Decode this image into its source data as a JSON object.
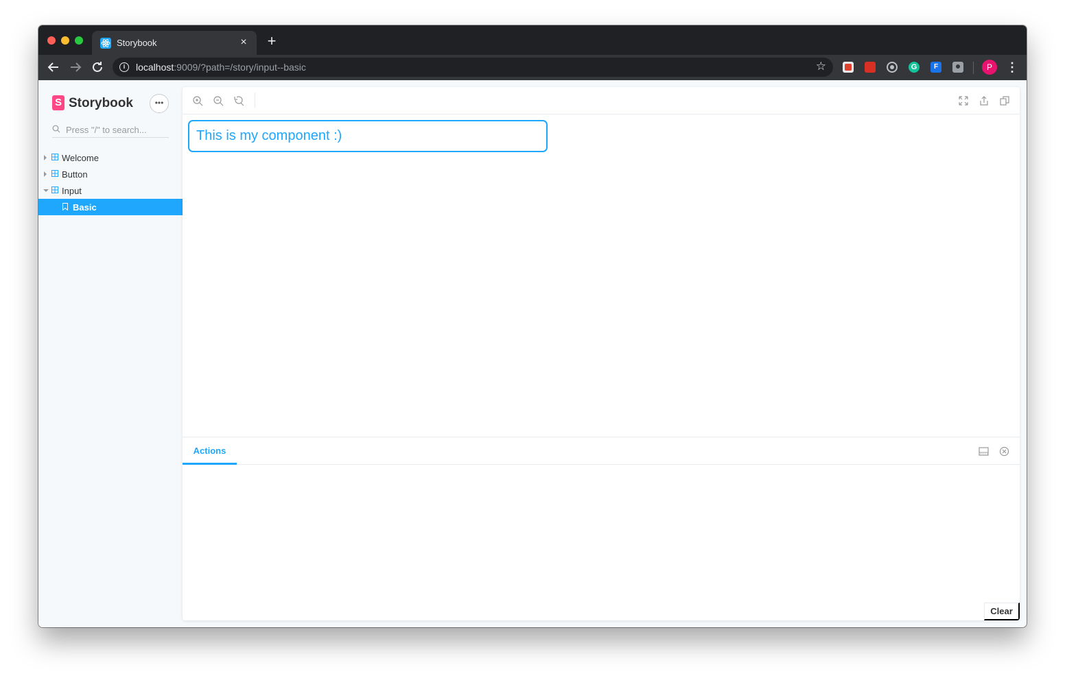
{
  "browser": {
    "tab_title": "Storybook",
    "tab_close_icon": "×",
    "new_tab_icon": "+",
    "url_host": "localhost",
    "url_rest": ":9009/?path=/story/input--basic",
    "profile_initial": "P",
    "ext_grammarly": "G",
    "ext_f": "F"
  },
  "sidebar": {
    "brand": "Storybook",
    "menu_label": "•••",
    "search_placeholder": "Press \"/\" to search...",
    "items": [
      {
        "label": "Welcome",
        "expanded": false
      },
      {
        "label": "Button",
        "expanded": false
      },
      {
        "label": "Input",
        "expanded": true
      },
      {
        "label": "Basic",
        "selected": true
      }
    ]
  },
  "preview": {
    "input_value": "This is my component :)"
  },
  "addons": {
    "active_tab": "Actions",
    "clear_label": "Clear"
  },
  "colors": {
    "accent": "#1ea7fd",
    "brand": "#ff4785"
  }
}
